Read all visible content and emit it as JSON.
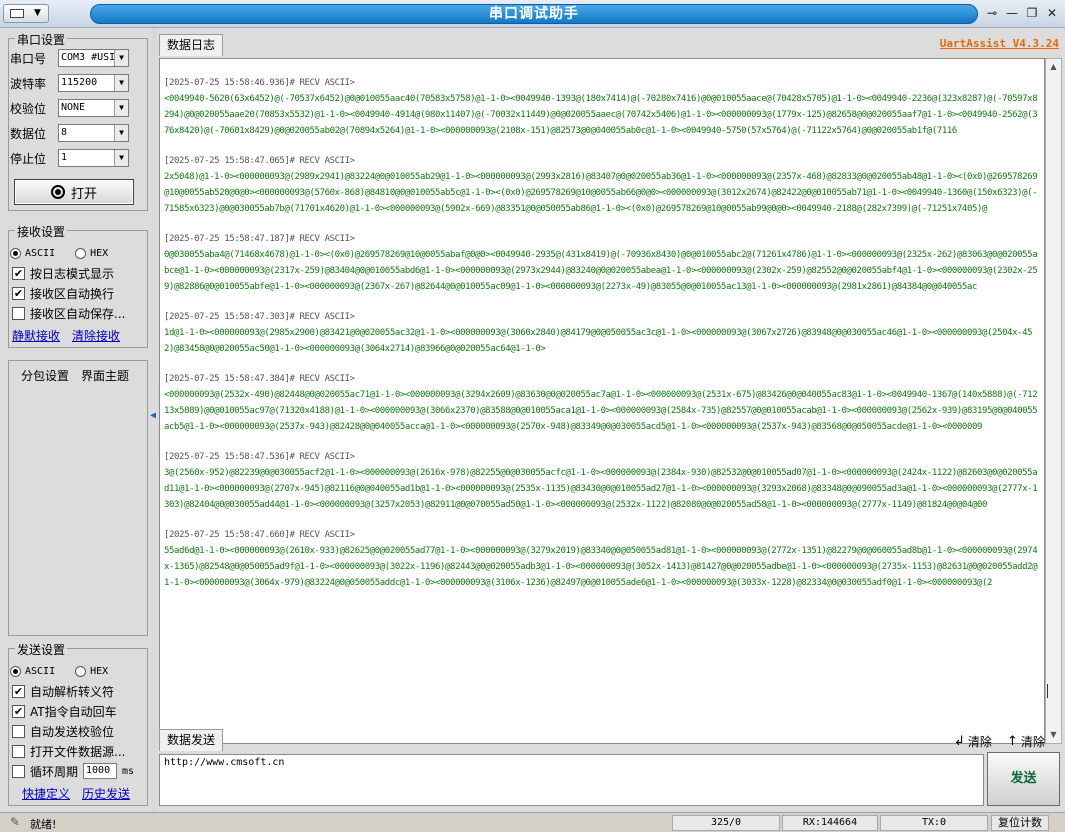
{
  "window": {
    "title": "串口调试助手"
  },
  "serial": {
    "group_title": "串口设置",
    "port_label": "串口号",
    "port_value": "COM3 #USI",
    "baud_label": "波特率",
    "baud_value": "115200",
    "parity_label": "校验位",
    "parity_value": "NONE",
    "databits_label": "数据位",
    "databits_value": "8",
    "stopbits_label": "停止位",
    "stopbits_value": "1",
    "open_label": "打开"
  },
  "receive": {
    "group_title": "接收设置",
    "ascii_label": "ASCII",
    "hex_label": "HEX",
    "opt1": "按日志模式显示",
    "opt2": "接收区自动换行",
    "opt3": "接收区自动保存...",
    "link_silent": "静默接收",
    "link_clear": "清除接收"
  },
  "left_tabs": {
    "tab1": "分包设置",
    "tab2": "界面主题"
  },
  "send_settings": {
    "group_title": "发送设置",
    "ascii_label": "ASCII",
    "hex_label": "HEX",
    "opt1": "自动解析转义符",
    "opt2": "AT指令自动回车",
    "opt3": "自动发送校验位",
    "opt4": "打开文件数据源...",
    "opt5": "循环周期",
    "cycle_value": "1000",
    "cycle_unit": "ms",
    "link_shortcut": "快捷定义",
    "link_history": "历史发送"
  },
  "log": {
    "tab": "数据日志",
    "brand": "UartAssist V4.3.24",
    "entries": [
      {
        "header": "[2025-07-25 15:58:46.936]# RECV ASCII>",
        "data": "<0049940-5620(63x6452)@(-70537x6452)@0@010055aac40(70583x5758)@1-1-0><0049940-1393@(180x7414)@(-70280x7416)@0@010055aace@(70428x5705)@1-1-0><0049940-2236@(323x8287)@(-70597x8294)@0@020055aae20(70853x5532)@1-1-0><0049940-4914@(980x11407)@(-70032x11449)@0@020055aaec@(70742x5406)@1-1-0><000000093@(1779x-125)@82658@0@020055aaf7@1-1-0><0049940-2562@(376x8420)@(-70601x8429)@0@020055ab02@(70894x5264)@1-1-0><000000093@(2108x-151)@82573@0@040055ab0c@1-1-0><0049940-5750(57x5764)@(-71122x5764)@0@020055ab1f@(7116"
      },
      {
        "header": "[2025-07-25 15:58:47.065]# RECV ASCII>",
        "data": "2x5048)@1-1-0><000000093@(2989x2941)@83224@0@010055ab29@1-1-0><000000093@(2993x2816)@83407@0@020055ab36@1-1-0><000000093@(2357x-468)@82833@0@020055ab48@1-1-0><(0x0)@269578269@10@0055ab520@0@0><000000093@(5760x-868)@84810@0@010055ab5c@1-1-0><(0x0)@269578269@10@0055ab66@0@0><000000093@(3012x2674)@82422@0@010055ab71@1-1-0><0049940-1360@(150x6323)@(-71585x6323)@0@030055ab7b@(71701x4620)@1-1-0><000000093@(5902x-669)@83351@0@050055ab86@1-1-0><(0x0)@269578269@10@0055ab99@0@0><0049940-2188@(282x7399)@(-71251x7405)@"
      },
      {
        "header": "[2025-07-25 15:58:47.187]# RECV ASCII>",
        "data": "0@030055aba4@(71468x4678)@1-1-0><(0x0)@269578269@10@0055abaf@0@0><0049940-2935@(431x8419)@(-70936x8430)@0@010055abc2@(71261x4786)@1-1-0><000000093@(2325x-262)@83063@0@020055abce@1-1-0><000000093@(2317x-259)@83404@0@010055abd6@1-1-0><000000093@(2973x2944)@83240@0@020055abea@1-1-0><000000093@(2302x-259)@82552@0@020055abf4@1-1-0><000000093@(2302x-259)@82886@0@010055abfe@1-1-0><000000093@(2367x-267)@82644@0@010055ac09@1-1-0><000000093@(2273x-49)@83055@0@010055ac13@1-1-0><000000093@(2981x2861)@84384@0@040055ac"
      },
      {
        "header": "[2025-07-25 15:58:47.303]# RECV ASCII>",
        "data": "1d@1-1-0><000000093@(2985x2900)@83421@0@020055ac32@1-1-0><000000093@(3060x2840)@84179@0@050055ac3c@1-1-0><000000093@(3067x2726)@83948@0@030055ac46@1-1-0><000000093@(2504x-452)@83458@0@020055ac50@1-1-0><000000093@(3064x2714)@83966@0@020055ac64@1-1-0>"
      },
      {
        "header": "[2025-07-25 15:58:47.384]# RECV ASCII>",
        "data": "<000000093@(2532x-490)@82448@0@020055ac71@1-1-0><000000093@(3294x2609)@83630@0@020055ac7a@1-1-0><000000093@(2531x-675)@83426@0@040055ac83@1-1-0><0049940-1367@(140x5888)@(-71213x5889)@0@010055ac97@(71320x4188)@1-1-0><000000093@(3066x2370)@83588@0@010055aca1@1-1-0><000000093@(2584x-735)@82557@0@010055acab@1-1-0><000000093@(2562x-939)@83195@0@040055acb5@1-1-0><000000093@(2537x-943)@82428@0@040055acca@1-1-0><000000093@(2570x-948)@83349@0@030055acd5@1-1-0><000000093@(2537x-943)@83568@0@050055acde@1-1-0><0000009"
      },
      {
        "header": "[2025-07-25 15:58:47.536]# RECV ASCII>",
        "data": "3@(2560x-952)@82239@0@030055acf2@1-1-0><000000093@(2616x-978)@82255@0@030055acfc@1-1-0><000000093@(2384x-930)@82532@0@010055ad07@1-1-0><000000093@(2424x-1122)@82603@0@020055ad11@1-1-0><000000093@(2707x-945)@82116@0@040055ad1b@1-1-0><000000093@(2535x-1135)@83430@0@010055ad27@1-1-0><000000093@(3293x2068)@83348@0@090055ad3a@1-1-0><000000093@(2777x-1303)@82404@0@030055ad44@1-1-0><000000093@(3257x2053)@82911@0@070055ad50@1-1-0><000000093@(2532x-1122)@82080@0@020055ad58@1-1-0><000000093@(2777x-1149)@81824@0@04@00"
      },
      {
        "header": "[2025-07-25 15:58:47.660]# RECV ASCII>",
        "data": "55ad6d@1-1-0><000000093@(2610x-933)@82625@0@020055ad77@1-1-0><000000093@(3279x2019)@83340@0@050055ad81@1-1-0><000000093@(2772x-1351)@82279@0@060055ad8b@1-1-0><000000093@(2974x-1365)@82548@0@050055ad9f@1-1-0><000000093@(3022x-1196)@82443@0@020055adb3@1-1-0><000000093@(3052x-1413)@81427@0@020055adbe@1-1-0><000000093@(2735x-1153)@82631@0@020055add2@1-1-0><000000093@(3064x-979)@83224@0@050055addc@1-1-0><000000093@(3106x-1236)@82497@0@010055ade6@1-1-0><000000093@(3033x-1228)@82334@0@030055adf0@1-1-0><000000093@(2"
      }
    ]
  },
  "send": {
    "tab": "数据发送",
    "clear1": "清除",
    "clear2": "清除",
    "input_value": "http://www.cmsoft.cn",
    "send_label": "发送"
  },
  "status": {
    "ready": "就绪!",
    "counter": "325/0",
    "rx": "RX:144664",
    "tx": "TX:0",
    "reset": "复位计数"
  }
}
